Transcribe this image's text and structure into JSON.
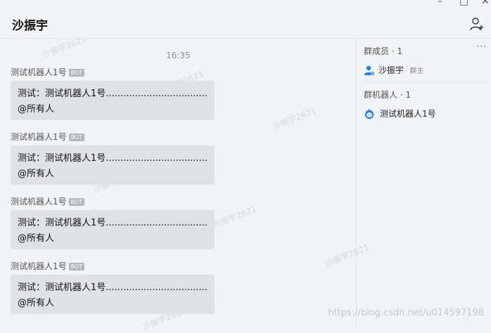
{
  "window": {
    "title": "沙振宇",
    "controls": {
      "minimize": "–",
      "maximize": "□",
      "close": "✕"
    }
  },
  "chat": {
    "timestamp": "16:35",
    "messages": [
      {
        "sender": "测试机器人1号",
        "badge": "BOT",
        "line1": "测试：测试机器人1号.....................................!",
        "line2": "@所有人"
      },
      {
        "sender": "测试机器人1号",
        "badge": "BOT",
        "line1": "测试：测试机器人1号.....................................!",
        "line2": "@所有人"
      },
      {
        "sender": "测试机器人1号",
        "badge": "BOT",
        "line1": "测试：测试机器人1号.....................................!",
        "line2": "@所有人"
      },
      {
        "sender": "测试机器人1号",
        "badge": "BOT",
        "line1": "测试：测试机器人1号.....................................!",
        "line2": "@所有人"
      }
    ]
  },
  "sidebar": {
    "members_header": "群成员 · 1",
    "more": "···",
    "member": {
      "name": "沙振宇",
      "role": "· 群主",
      "icon": "user-icon"
    },
    "robots_header": "群机器人 · 1",
    "robot": {
      "name": "测试机器人1号",
      "icon": "robot-icon"
    }
  },
  "watermark": "沙振宇2621",
  "footer_url": "https://blog.csdn.net/u014597198",
  "colors": {
    "background": "#f2f3f5",
    "bubble": "#dfe1e4",
    "accent": "#1e7ff0",
    "badge": "#b3b7bd"
  }
}
